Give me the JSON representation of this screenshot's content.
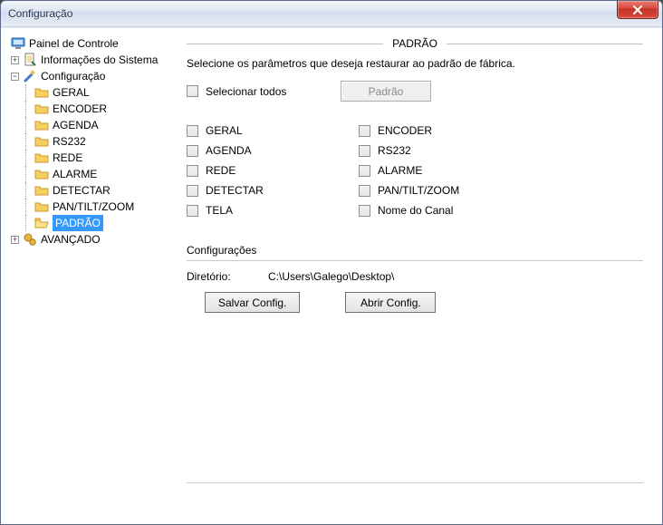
{
  "window": {
    "title": "Configuração"
  },
  "tree": {
    "root": "Painel de Controle",
    "info": "Informações do Sistema",
    "config": "Configuração",
    "items": [
      "GERAL",
      "ENCODER",
      "AGENDA",
      "RS232",
      "REDE",
      "ALARME",
      "DETECTAR",
      "PAN/TILT/ZOOM",
      "PADRÃO"
    ],
    "advanced": "AVANÇADO"
  },
  "panel": {
    "heading": "PADRÃO",
    "desc": "Selecione os parâmetros que deseja restaurar ao padrão de fábrica.",
    "select_all": "Selecionar todos",
    "default_btn": "Padrão",
    "options_left": [
      "GERAL",
      "AGENDA",
      "REDE",
      "DETECTAR",
      "TELA"
    ],
    "options_right": [
      "ENCODER",
      "RS232",
      "ALARME",
      "PAN/TILT/ZOOM",
      "Nome do Canal"
    ],
    "group_label": "Configurações",
    "dir_label": "Diretório:",
    "dir_value": "C:\\Users\\Galego\\Desktop\\",
    "save_btn": "Salvar Config.",
    "open_btn": "Abrir Config."
  }
}
